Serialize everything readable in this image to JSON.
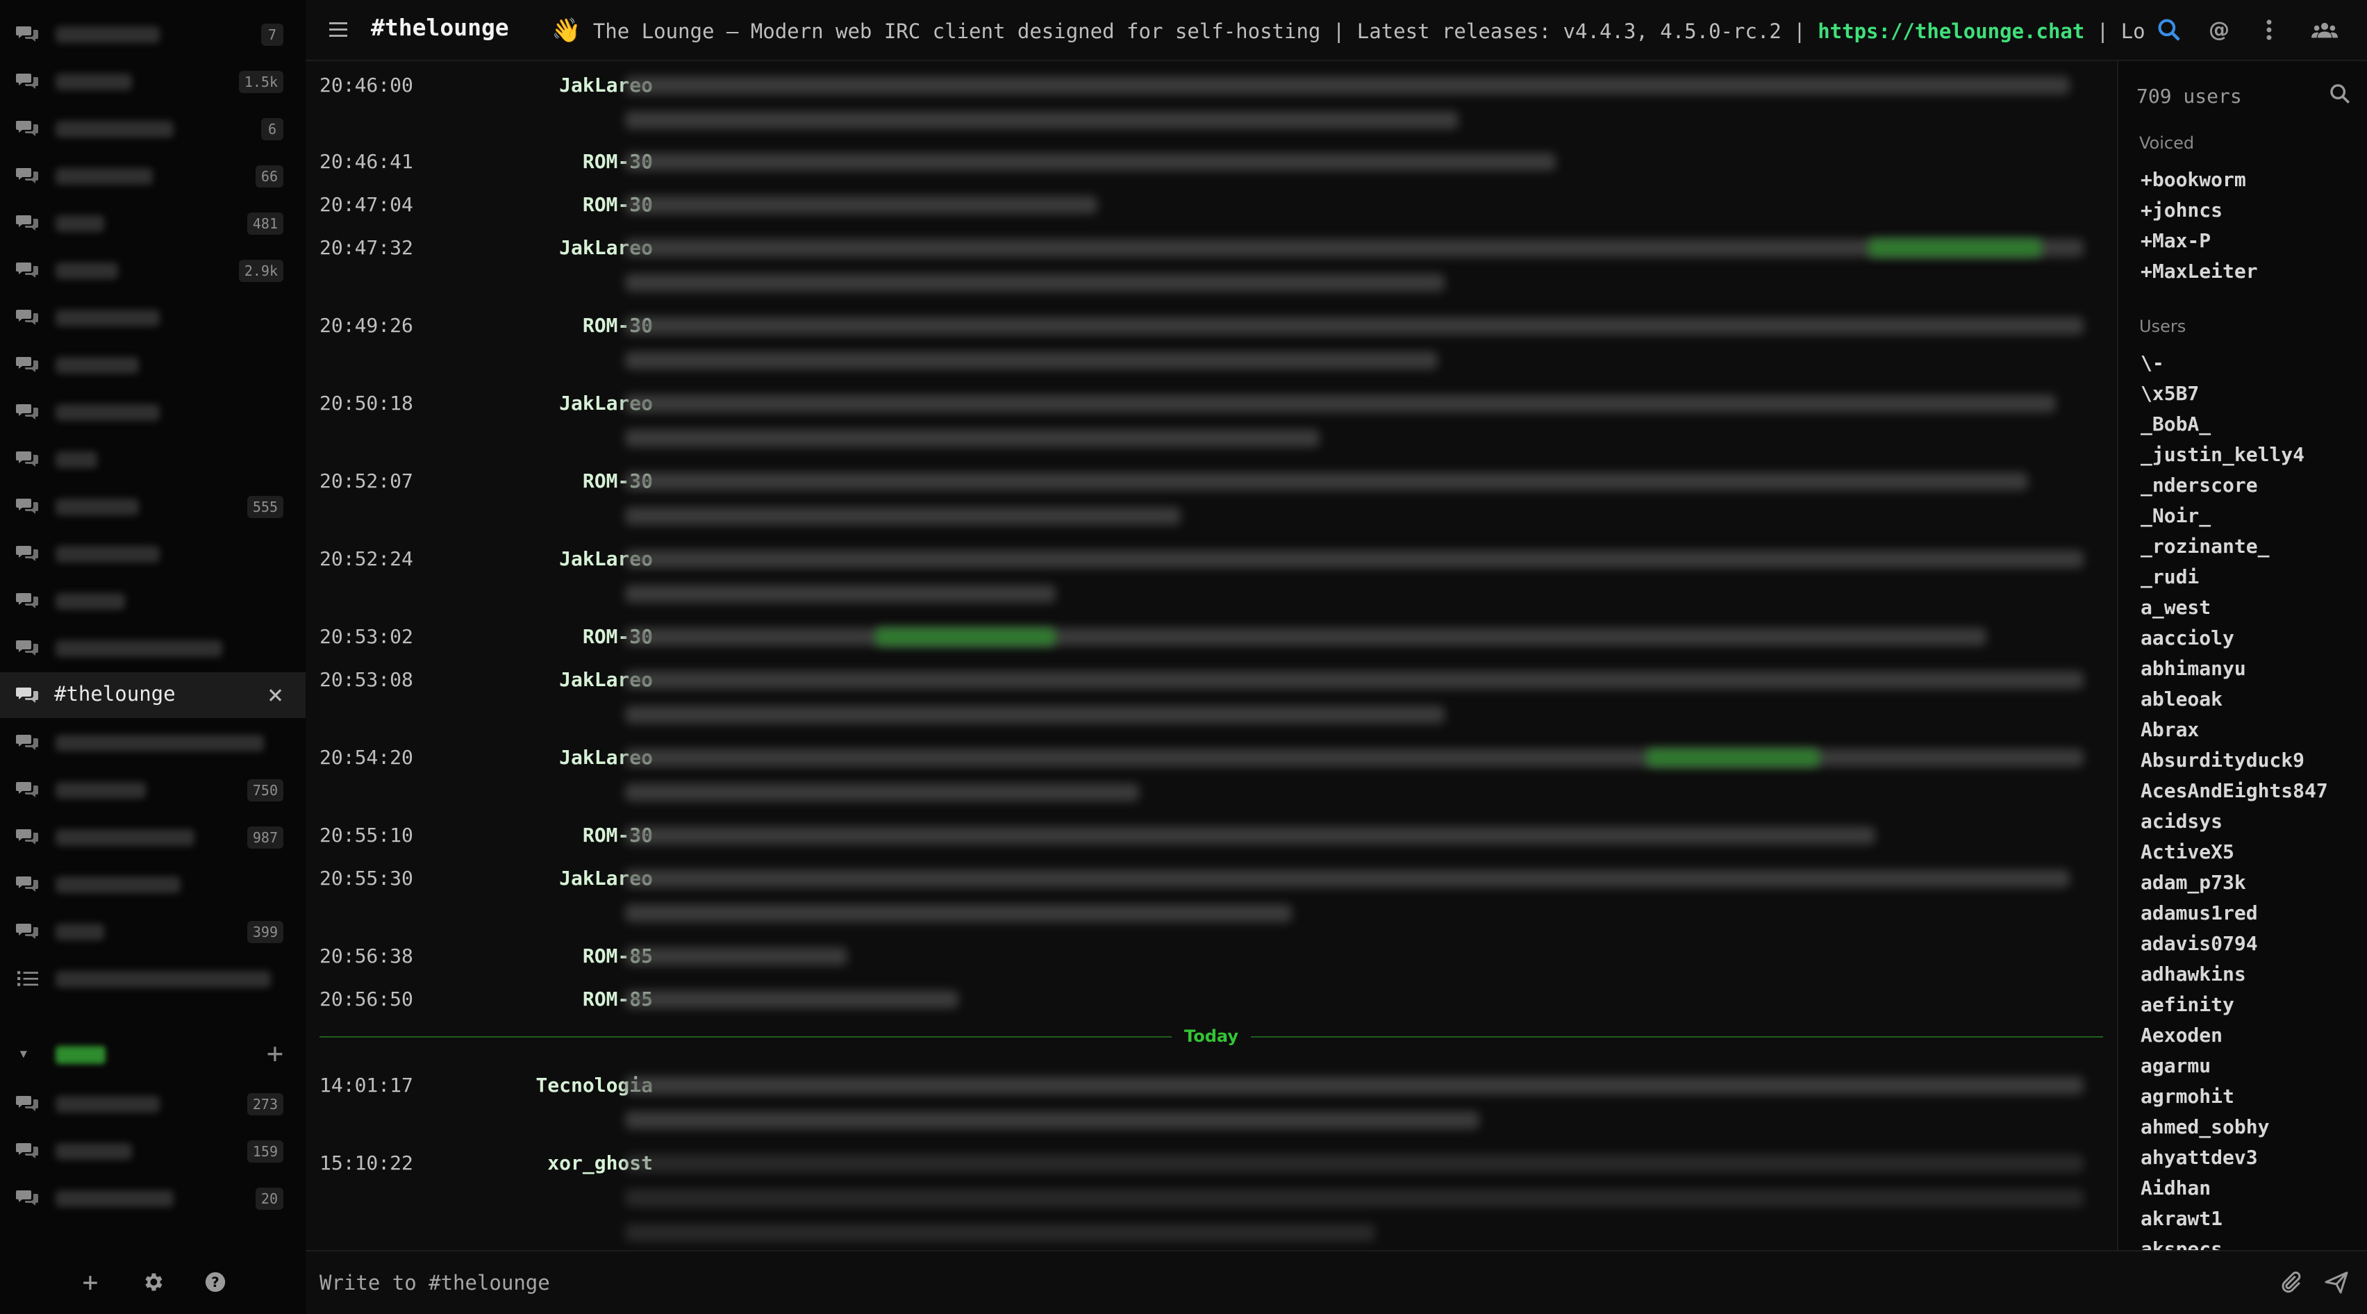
{
  "sidebar": {
    "channels_top": [
      {
        "badge": "7",
        "w": 0
      },
      {
        "badge": "1.5k"
      },
      {
        "badge": "6"
      },
      {
        "badge": "66"
      },
      {
        "badge": "481"
      },
      {
        "badge": "2.9k"
      },
      {
        "badge": ""
      },
      {
        "badge": ""
      },
      {
        "badge": ""
      },
      {
        "badge": ""
      },
      {
        "badge": "555"
      },
      {
        "badge": ""
      },
      {
        "badge": ""
      },
      {
        "badge": ""
      }
    ],
    "active_channel": "#thelounge",
    "channels_after": [
      {
        "badge": ""
      },
      {
        "badge": "750"
      },
      {
        "badge": "987"
      },
      {
        "badge": ""
      },
      {
        "badge": "399"
      }
    ],
    "second_network_channels": [
      {
        "badge": "273"
      },
      {
        "badge": "159"
      },
      {
        "badge": "20"
      }
    ]
  },
  "topbar": {
    "channel_name": "#thelounge",
    "topic_emoji": "👋",
    "topic_text": " The Lounge — Modern web IRC client designed for self-hosting | Latest releases: v4.4.3, 4.5.0-rc.2 | ",
    "topic_link": "https://thelounge.chat",
    "topic_tail": " | Looking for"
  },
  "messages": [
    {
      "time": "20:46:00",
      "nick": "JakLareo"
    },
    {
      "time": "20:46:41",
      "nick": "ROM-30"
    },
    {
      "time": "20:47:04",
      "nick": "ROM-30"
    },
    {
      "time": "20:47:32",
      "nick": "JakLareo"
    },
    {
      "time": "20:49:26",
      "nick": "ROM-30"
    },
    {
      "time": "20:50:18",
      "nick": "JakLareo"
    },
    {
      "time": "20:52:07",
      "nick": "ROM-30"
    },
    {
      "time": "20:52:24",
      "nick": "JakLareo"
    },
    {
      "time": "20:53:02",
      "nick": "ROM-30"
    },
    {
      "time": "20:53:08",
      "nick": "JakLareo"
    },
    {
      "time": "20:54:20",
      "nick": "JakLareo"
    },
    {
      "time": "20:55:10",
      "nick": "ROM-30"
    },
    {
      "time": "20:55:30",
      "nick": "JakLareo"
    },
    {
      "time": "20:56:38",
      "nick": "ROM-85"
    },
    {
      "time": "20:56:50",
      "nick": "ROM-85"
    },
    {
      "time": "14:01:17",
      "nick": "Tecnologia"
    },
    {
      "time": "15:10:22",
      "nick": "xor_ghost"
    }
  ],
  "day_divider": "Today",
  "userlist": {
    "count": "709 users",
    "voiced_title": "Voiced",
    "voiced": [
      "+bookworm",
      "+johncs",
      "+Max-P",
      "+MaxLeiter"
    ],
    "users_title": "Users",
    "users": [
      "\\-",
      "\\x5B7",
      "_BobA_",
      "_justin_kelly4",
      "_nderscore",
      "_Noir_",
      "_rozinante_",
      "_rudi",
      "a_west",
      "aaccioly",
      "abhimanyu",
      "ableoak",
      "Abrax",
      "Absurdityduck9",
      "AcesAndEights847",
      "acidsys",
      "ActiveX5",
      "adam_p73k",
      "adamus1red",
      "adavis0794",
      "adhawkins",
      "aefinity",
      "Aexoden",
      "agarmu",
      "agrmohit",
      "ahmed_sobhy",
      "ahyattdev3",
      "Aidhan",
      "akrawt1",
      "akspecs"
    ]
  },
  "input": {
    "placeholder": "Write to #thelounge"
  }
}
